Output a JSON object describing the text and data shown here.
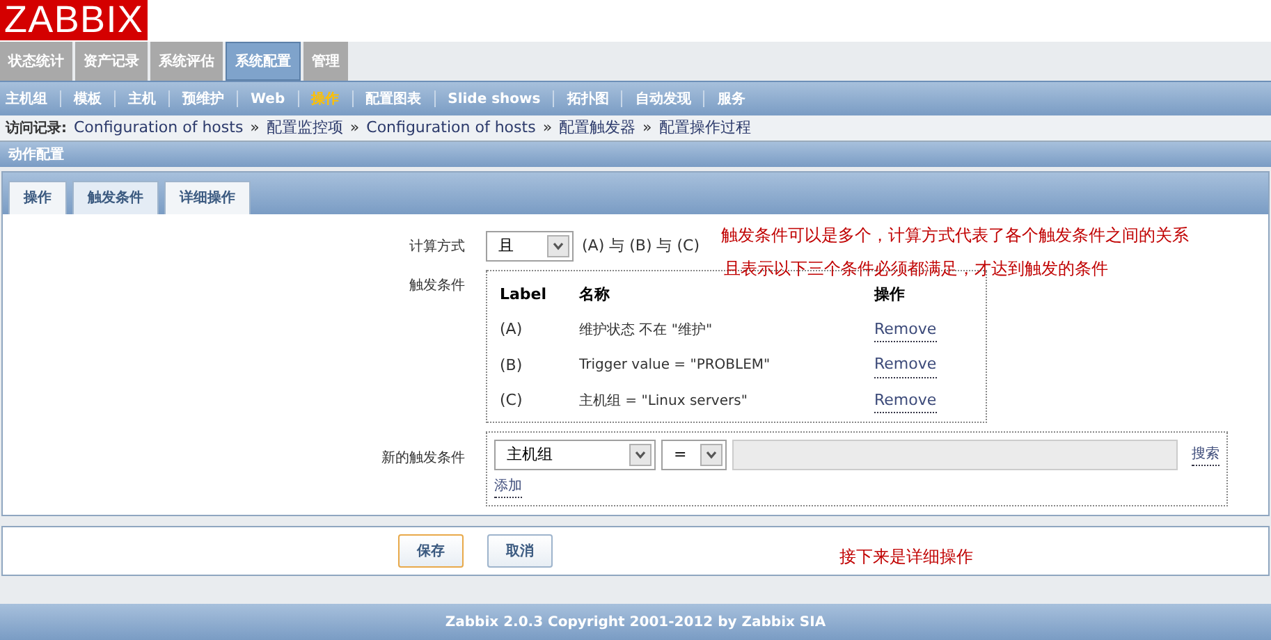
{
  "logo": "ZABBIX",
  "main_menu": [
    {
      "label": "状态统计",
      "selected": false
    },
    {
      "label": "资产记录",
      "selected": false
    },
    {
      "label": "系统评估",
      "selected": false
    },
    {
      "label": "系统配置",
      "selected": true
    },
    {
      "label": "管理",
      "selected": false
    }
  ],
  "sub_menu": [
    {
      "label": "主机组",
      "selected": false
    },
    {
      "label": "模板",
      "selected": false
    },
    {
      "label": "主机",
      "selected": false
    },
    {
      "label": "预维护",
      "selected": false
    },
    {
      "label": "Web",
      "selected": false
    },
    {
      "label": "操作",
      "selected": true
    },
    {
      "label": "配置图表",
      "selected": false
    },
    {
      "label": "Slide shows",
      "selected": false
    },
    {
      "label": "拓扑图",
      "selected": false
    },
    {
      "label": "自动发现",
      "selected": false
    },
    {
      "label": "服务",
      "selected": false
    }
  ],
  "breadcrumb": {
    "label": "访问记录:",
    "separator": "»",
    "items": [
      "Configuration of hosts",
      "配置监控项",
      "Configuration of hosts",
      "配置触发器",
      "配置操作过程"
    ]
  },
  "page_title": "动作配置",
  "tabs": [
    {
      "label": "操作",
      "selected": false
    },
    {
      "label": "触发条件",
      "selected": true
    },
    {
      "label": "详细操作",
      "selected": false
    }
  ],
  "calculation": {
    "label": "计算方式",
    "value": "且",
    "expression": "(A) 与 (B) 与 (C)"
  },
  "conditions": {
    "label": "触发条件",
    "columns": [
      "Label",
      "名称",
      "操作"
    ],
    "rows": [
      {
        "label": "(A)",
        "name": "维护状态 不在 \"维护\"",
        "action": "Remove"
      },
      {
        "label": "(B)",
        "name": "Trigger value = \"PROBLEM\"",
        "action": "Remove"
      },
      {
        "label": "(C)",
        "name": "主机组 = \"Linux servers\"",
        "action": "Remove"
      }
    ]
  },
  "new_condition": {
    "label": "新的触发条件",
    "type": "主机组",
    "operator": "=",
    "search": "搜索",
    "add": "添加"
  },
  "annotations": [
    "触发条件可以是多个，计算方式代表了各个触发条件之间的关系",
    "且表示以下三个条件必须都满足，才达到触发的条件",
    "接下来是详细操作"
  ],
  "buttons": [
    {
      "label": "保存",
      "focused": true
    },
    {
      "label": "取消",
      "focused": false
    }
  ],
  "footer": "Zabbix 2.0.3 Copyright 2001-2012 by Zabbix SIA"
}
